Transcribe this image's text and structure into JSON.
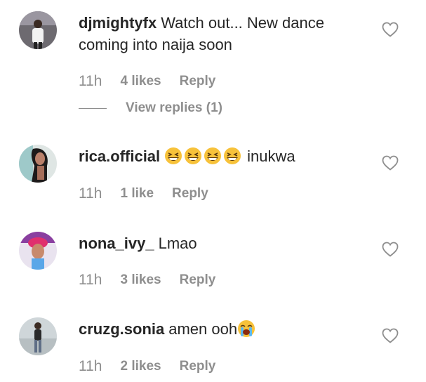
{
  "comments": [
    {
      "username": "djmightyfx",
      "text": "Watch out... New dance coming into naija soon",
      "time": "11h",
      "likes": "4 likes",
      "reply": "Reply",
      "view_replies": "View replies (1)"
    },
    {
      "username": "rica.official",
      "emoji_before": [
        "grinning-squinting-face",
        "grinning-squinting-face",
        "grinning-squinting-face",
        "grinning-squinting-face"
      ],
      "text": "inukwa",
      "time": "11h",
      "likes": "1 like",
      "reply": "Reply"
    },
    {
      "username": "nona_ivy_",
      "text": "Lmao",
      "time": "11h",
      "likes": "3 likes",
      "reply": "Reply"
    },
    {
      "username": "cruzg.sonia",
      "text": "amen ooh",
      "emoji_after": [
        "loudly-crying-face"
      ],
      "time": "11h",
      "likes": "2 likes",
      "reply": "Reply"
    }
  ],
  "colors": {
    "text": "#262626",
    "secondary": "#8e8e8e",
    "emoji_yellow": "#f7c23a"
  }
}
